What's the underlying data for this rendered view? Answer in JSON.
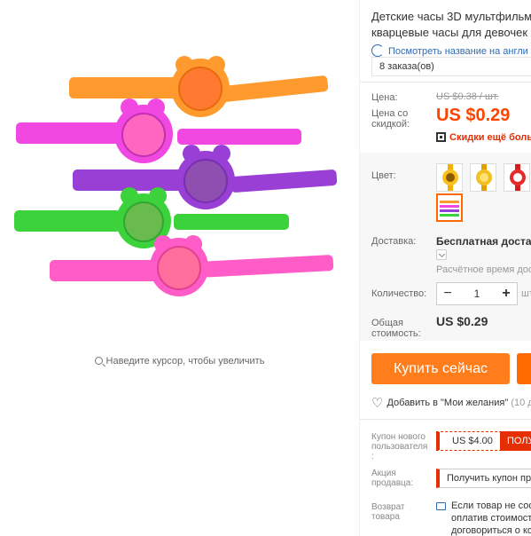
{
  "gallery": {
    "zoom_hint": "Наведите курсор, чтобы увеличить",
    "watch_colors": [
      "#ff9a2e",
      "#f048e0",
      "#9a3fd6",
      "#3cd23c",
      "#ff5cc8"
    ],
    "watch_face_colors": [
      "#ff7a30",
      "#ff66c0",
      "#8e4fb0",
      "#69bb4e",
      "#ff6e9c"
    ]
  },
  "product": {
    "title_line1": "Детские часы 3D мультфильм",
    "title_line2": "кварцевые часы для девочек",
    "translate_link": "Посмотреть название на англи",
    "orders": "8 заказа(ов)"
  },
  "price": {
    "label": "Цена:",
    "old": "US $0.38 / шт.",
    "discount_label_1": "Цена со",
    "discount_label_2": "скидкой:",
    "current": "US $0.29",
    "more_discounts": "Скидки ещё больш"
  },
  "options": {
    "color_label": "Цвет:",
    "shipping_label": "Доставка:",
    "shipping_value": "Бесплатная доставка",
    "estimated_time": "Расчётное время дост",
    "quantity_label": "Количество:",
    "quantity": "1",
    "minus": "−",
    "plus": "+",
    "unit": "шт",
    "total_label_1": "Общая",
    "total_label_2": "стоимость:",
    "total": "US $0.29"
  },
  "actions": {
    "buy_now": "Купить сейчас",
    "wishlist": "Добавить в \"Мои желания\"",
    "wishlist_count": "(10 д"
  },
  "coupons": {
    "new_user_label_1": "Купон нового",
    "new_user_label_2": "пользователя",
    "new_user_label_3": ":",
    "new_user_value": "US $4.00",
    "new_user_action": "ПОЛУ",
    "seller_label_1": "Акция",
    "seller_label_2": "продавца:",
    "seller_action": "Получить купон пр"
  },
  "returns": {
    "label_1": "Возврат",
    "label_2": "товара",
    "text_line1": "Если товар не соот",
    "text_line2": "оплатив стоимост",
    "text_line3": "договориться о ко"
  },
  "colors": {
    "accent": "#ff4400",
    "buy_button": "#ff7d1a",
    "link": "#2e6bb4",
    "coupon": "#e62e04"
  }
}
